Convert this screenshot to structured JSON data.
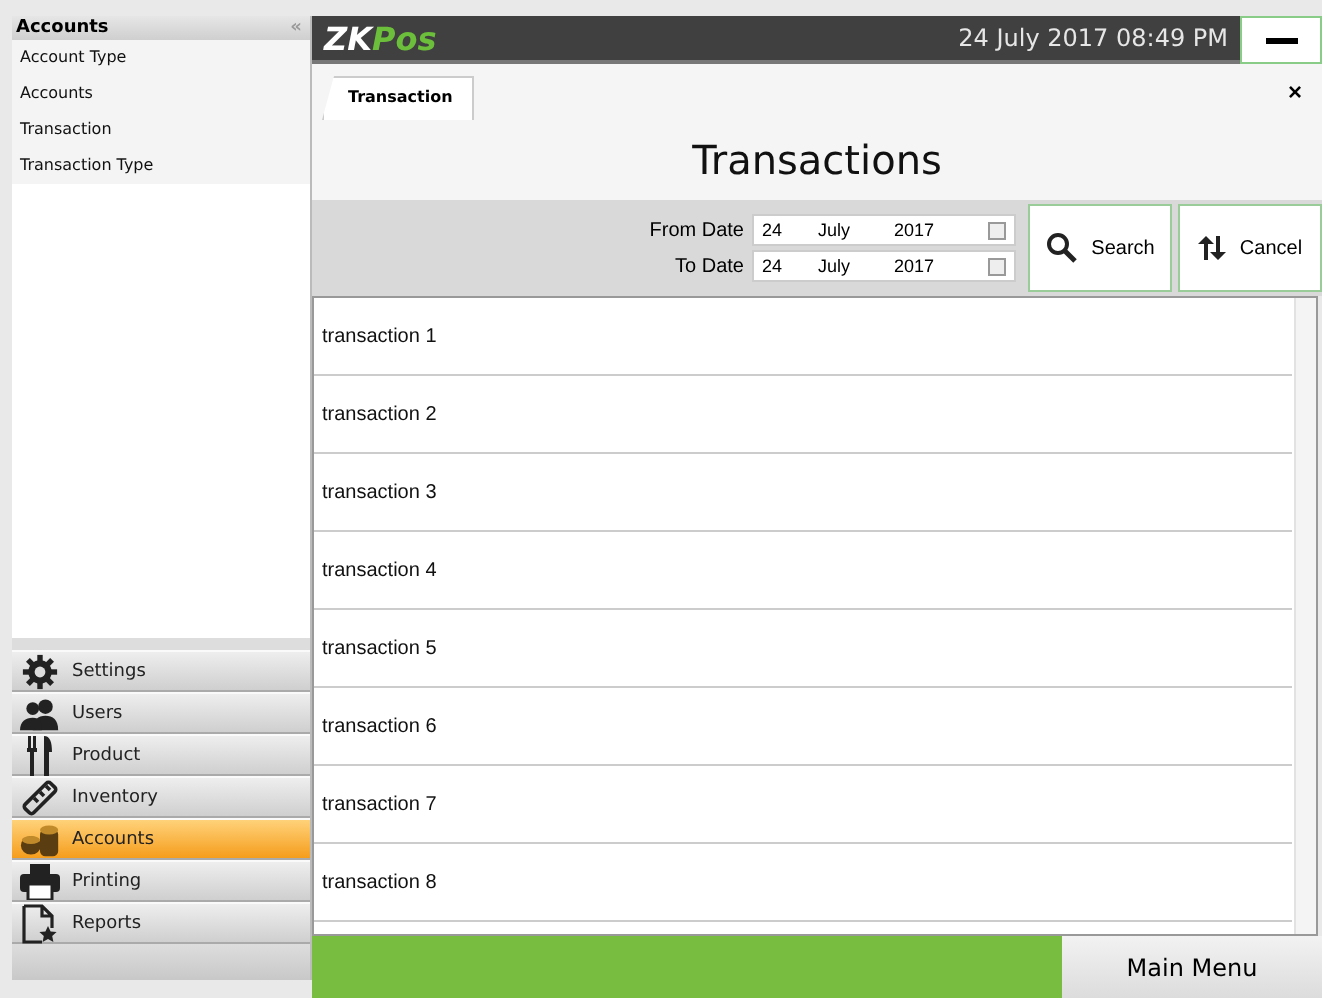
{
  "sidebar": {
    "title": "Accounts",
    "collapse": "«",
    "items": [
      {
        "label": "Account Type",
        "selected": false
      },
      {
        "label": "Accounts",
        "selected": false
      },
      {
        "label": "Transaction",
        "selected": false
      },
      {
        "label": "Transaction Type",
        "selected": false
      }
    ],
    "modules": [
      {
        "label": "Settings",
        "kind": "gear",
        "selected": false
      },
      {
        "label": "Users",
        "kind": "users",
        "selected": false
      },
      {
        "label": "Product",
        "kind": "cutlery",
        "selected": false
      },
      {
        "label": "Inventory",
        "kind": "ruler",
        "selected": false
      },
      {
        "label": "Accounts",
        "kind": "coins",
        "selected": true
      },
      {
        "label": "Printing",
        "kind": "printer",
        "selected": false
      },
      {
        "label": "Reports",
        "kind": "report",
        "selected": false
      }
    ]
  },
  "header": {
    "logo_left": "ZK",
    "logo_right": "Pos",
    "datetime": "24 July 2017 08:49 PM"
  },
  "tabs": [
    {
      "label": "Transaction",
      "selected": true
    }
  ],
  "close": "×",
  "page_title": "Transactions",
  "filter": {
    "dates": [
      {
        "label": "From Date",
        "day": "24",
        "month": "July",
        "year": "2017"
      },
      {
        "label": "To Date",
        "day": "24",
        "month": "July",
        "year": "2017"
      }
    ],
    "buttons": [
      {
        "label": "Search",
        "kind": "search"
      },
      {
        "label": "Cancel",
        "kind": "swap"
      }
    ]
  },
  "rows": [
    "transaction 1",
    "transaction 2",
    "transaction 3",
    "transaction 4",
    "transaction 5",
    "transaction 6",
    "transaction 7",
    "transaction 8"
  ],
  "footer": {
    "main_menu": "Main Menu"
  }
}
